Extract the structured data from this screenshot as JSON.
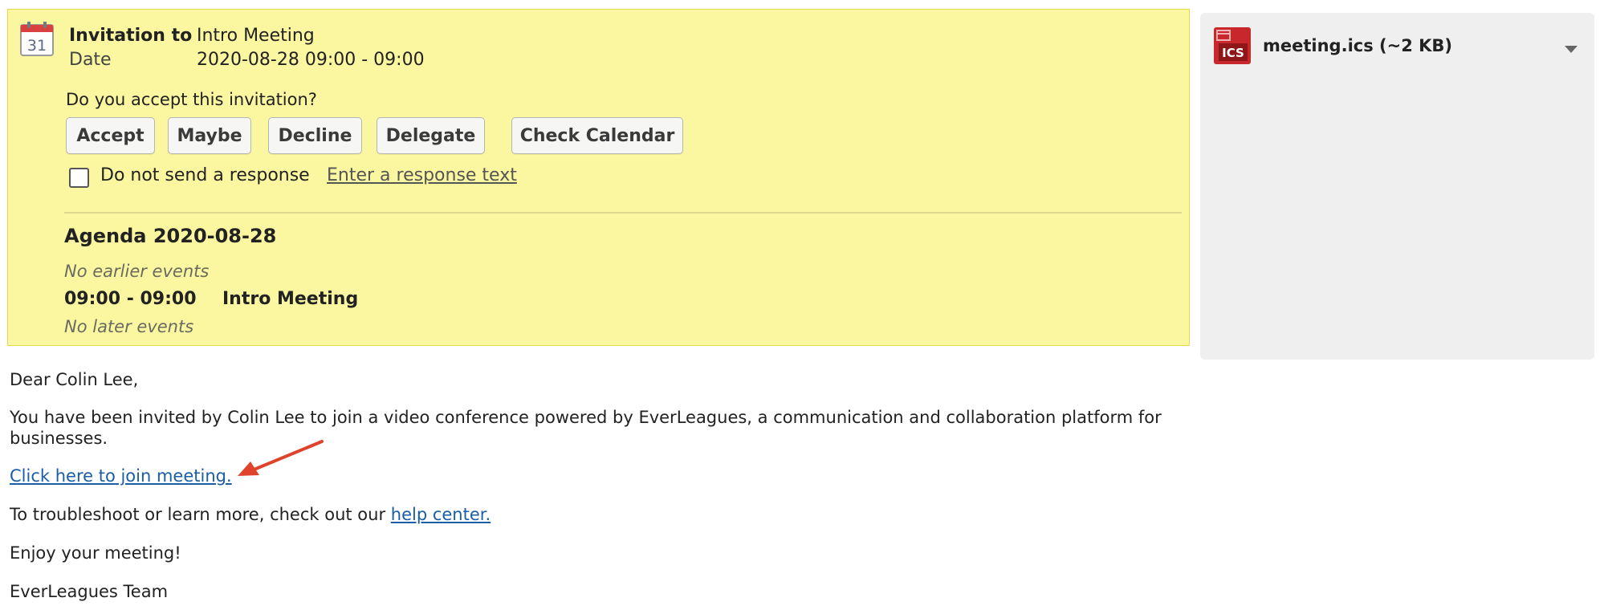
{
  "invitation": {
    "title_label": "Invitation to",
    "title_value": "Intro Meeting",
    "date_label": "Date",
    "date_value": "2020-08-28 09:00 - 09:00",
    "calendar_icon_day": "31",
    "question": "Do you accept this invitation?",
    "buttons": [
      "Accept",
      "Maybe",
      "Decline",
      "Delegate",
      "Check Calendar"
    ],
    "no_response_label": "Do not send a response",
    "no_response_checked": false,
    "response_link": "Enter a response text"
  },
  "agenda": {
    "title": "Agenda 2020-08-28",
    "no_earlier": "No earlier events",
    "event_time": "09:00 - 09:00",
    "event_title": "Intro Meeting",
    "no_later": "No later events"
  },
  "attachment": {
    "icon_label": "ICS",
    "name": "meeting.ics (~2 KB)"
  },
  "message": {
    "greeting": "Dear Colin Lee,",
    "paragraph1": "You have been invited by Colin Lee to join a video conference powered by EverLeagues, a communication and collaboration platform for businesses.",
    "join_link": "Click here to join meeting.",
    "troubleshoot_prefix": "To troubleshoot or learn more, check out our ",
    "help_link": "help center.",
    "enjoy": "Enjoy your meeting!",
    "signature": "EverLeagues Team"
  },
  "colors": {
    "invite_bg": "#fbf6a0",
    "link": "#1a5ea6",
    "arrow": "#e0432b"
  }
}
